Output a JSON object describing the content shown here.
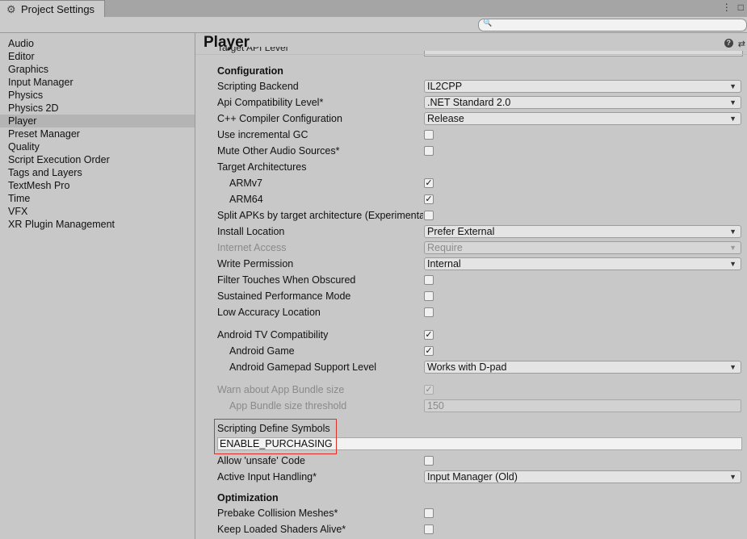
{
  "window": {
    "tab_title": "Project Settings",
    "tab_icon": "gear-icon"
  },
  "search": {
    "placeholder": ""
  },
  "sidebar": {
    "items": [
      {
        "label": "Audio"
      },
      {
        "label": "Editor"
      },
      {
        "label": "Graphics"
      },
      {
        "label": "Input Manager"
      },
      {
        "label": "Physics"
      },
      {
        "label": "Physics 2D"
      },
      {
        "label": "Player",
        "selected": true
      },
      {
        "label": "Preset Manager"
      },
      {
        "label": "Quality"
      },
      {
        "label": "Script Execution Order"
      },
      {
        "label": "Tags and Layers"
      },
      {
        "label": "TextMesh Pro"
      },
      {
        "label": "Time"
      },
      {
        "label": "VFX"
      },
      {
        "label": "XR Plugin Management"
      }
    ]
  },
  "main": {
    "title": "Player",
    "clipped_label": "Target API Level",
    "sections": {
      "configuration": "Configuration",
      "optimization": "Optimization"
    },
    "settings": {
      "scripting_backend": {
        "label": "Scripting Backend",
        "value": "IL2CPP"
      },
      "api_compat": {
        "label": "Api Compatibility Level*",
        "value": ".NET Standard 2.0"
      },
      "cpp_config": {
        "label": "C++ Compiler Configuration",
        "value": "Release"
      },
      "incremental_gc": {
        "label": "Use incremental GC",
        "checked": false
      },
      "mute_audio": {
        "label": "Mute Other Audio Sources*",
        "checked": false
      },
      "target_arch": {
        "label": "Target Architectures"
      },
      "armv7": {
        "label": "ARMv7",
        "checked": true
      },
      "arm64": {
        "label": "ARM64",
        "checked": true
      },
      "split_apks": {
        "label": "Split APKs by target architecture (Experimental)",
        "checked": false
      },
      "install_location": {
        "label": "Install Location",
        "value": "Prefer External"
      },
      "internet_access": {
        "label": "Internet Access",
        "value": "Require",
        "disabled": true
      },
      "write_permission": {
        "label": "Write Permission",
        "value": "Internal"
      },
      "filter_touches": {
        "label": "Filter Touches When Obscured",
        "checked": false
      },
      "sustained_perf": {
        "label": "Sustained Performance Mode",
        "checked": false
      },
      "low_accuracy": {
        "label": "Low Accuracy Location",
        "checked": false
      },
      "android_tv": {
        "label": "Android TV Compatibility",
        "checked": true
      },
      "android_game": {
        "label": "Android Game",
        "checked": true
      },
      "gamepad_support": {
        "label": "Android Gamepad Support Level",
        "value": "Works with D-pad"
      },
      "warn_bundle": {
        "label": "Warn about App Bundle size",
        "checked": true,
        "disabled": true
      },
      "bundle_threshold": {
        "label": "App Bundle size threshold",
        "value": "150",
        "disabled": true
      },
      "define_symbols": {
        "label": "Scripting Define Symbols",
        "value": "ENABLE_PURCHASING"
      },
      "allow_unsafe": {
        "label": "Allow 'unsafe' Code",
        "checked": false
      },
      "active_input": {
        "label": "Active Input Handling*",
        "value": "Input Manager (Old)"
      },
      "prebake": {
        "label": "Prebake Collision Meshes*",
        "checked": false
      },
      "keep_shaders": {
        "label": "Keep Loaded Shaders Alive*",
        "checked": false
      }
    },
    "check_glyph": "✓",
    "dropdown_glyph": "▼"
  },
  "colors": {
    "highlight_box": "#e0302a",
    "selected_item": "#b4b4b4"
  }
}
